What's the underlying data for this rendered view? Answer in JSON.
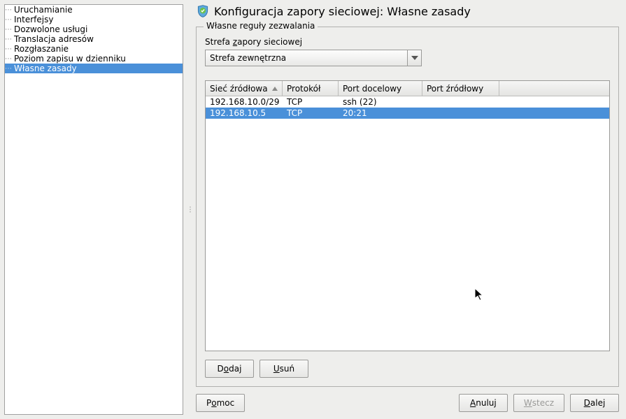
{
  "sidebar": {
    "items": [
      {
        "label": "Uruchamianie",
        "selected": false
      },
      {
        "label": "Interfejsy",
        "selected": false
      },
      {
        "label": "Dozwolone usługi",
        "selected": false
      },
      {
        "label": "Translacja adresów",
        "selected": false
      },
      {
        "label": "Rozgłaszanie",
        "selected": false
      },
      {
        "label": "Poziom zapisu w dzienniku",
        "selected": false
      },
      {
        "label": "Własne zasady",
        "selected": true
      }
    ]
  },
  "page": {
    "title": "Konfiguracja zapory sieciowej: Własne zasady"
  },
  "group": {
    "label": "Własne reguły zezwalania",
    "zone_label_pre": "Strefa ",
    "zone_label_key": "z",
    "zone_label_post": "apory sieciowej",
    "zone_value": "Strefa zewnętrzna"
  },
  "table": {
    "columns": {
      "src": "Sieć źródłowa",
      "proto": "Protokół",
      "dport": "Port docelowy",
      "sport": "Port źródłowy"
    },
    "rows": [
      {
        "src": "192.168.10.0/29",
        "proto": "TCP",
        "dport": "ssh (22)",
        "sport": "",
        "selected": false
      },
      {
        "src": "192.168.10.5",
        "proto": "TCP",
        "dport": "20:21",
        "sport": "",
        "selected": true
      }
    ]
  },
  "buttons": {
    "add_pre": "D",
    "add_key": "o",
    "add_post": "daj",
    "del_pre": "",
    "del_key": "U",
    "del_post": "suń",
    "help_pre": "P",
    "help_key": "o",
    "help_post": "moc",
    "cancel_pre": "",
    "cancel_key": "A",
    "cancel_post": "nuluj",
    "back_pre": "",
    "back_key": "W",
    "back_post": "stecz",
    "next_pre": "",
    "next_key": "D",
    "next_post": "alej"
  }
}
